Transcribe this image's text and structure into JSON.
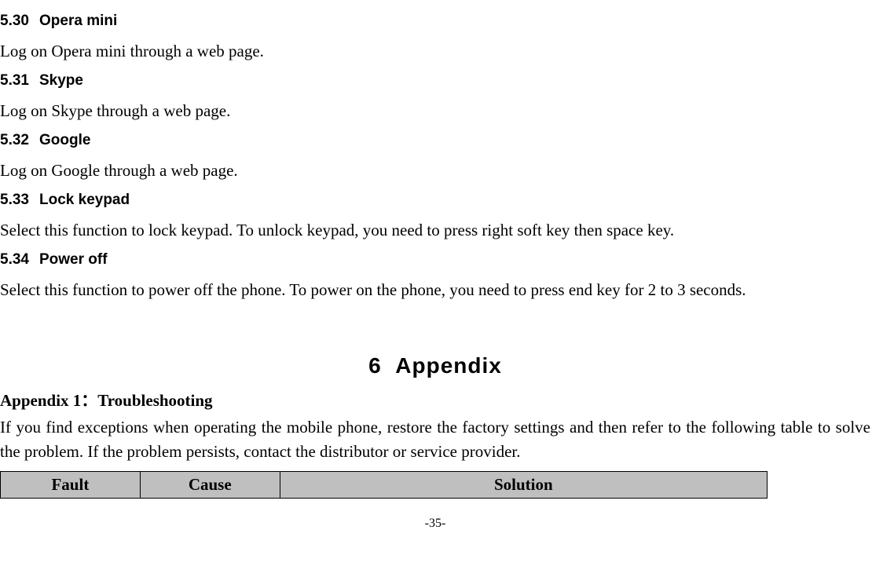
{
  "sections": [
    {
      "num": "5.30",
      "title": "Opera mini",
      "body": "Log on Opera mini through a web page."
    },
    {
      "num": "5.31",
      "title": "Skype",
      "body": "Log on Skype through a web page."
    },
    {
      "num": "5.32",
      "title": "Google",
      "body": "Log on Google through a web page."
    },
    {
      "num": "5.33",
      "title": "Lock keypad",
      "body": "Select this function to lock keypad. To unlock keypad, you need to press right soft key then space key."
    },
    {
      "num": "5.34",
      "title": "Power off",
      "body": "Select this function to power off the phone. To power on the phone, you need to press end key for 2 to 3 seconds."
    }
  ],
  "chapter": {
    "num": "6",
    "title": "Appendix"
  },
  "appendix": {
    "title": "Appendix 1：Troubleshooting",
    "intro": "If you find exceptions when operating the mobile phone, restore the factory settings and then refer to the following table to solve the problem. If the problem persists, contact the distributor or service provider."
  },
  "table": {
    "headers": [
      "Fault",
      "Cause",
      "Solution"
    ]
  },
  "pageNumber": "-35-"
}
